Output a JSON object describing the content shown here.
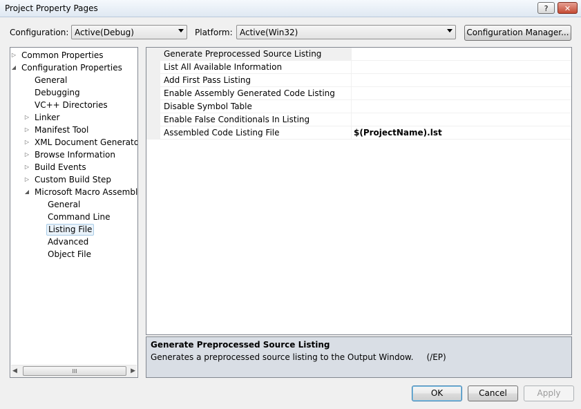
{
  "window": {
    "title": "Project Property Pages",
    "help_glyph": "?",
    "close_glyph": "✕"
  },
  "top": {
    "configuration_label": "Configuration:",
    "configuration_value": "Active(Debug)",
    "platform_label": "Platform:",
    "platform_value": "Active(Win32)",
    "config_manager_label": "Configuration Manager..."
  },
  "tree": {
    "items": [
      {
        "label": "Common Properties",
        "expander": "▷"
      },
      {
        "label": "Configuration Properties",
        "expander": "◢"
      },
      {
        "label": "General"
      },
      {
        "label": "Debugging"
      },
      {
        "label": "VC++ Directories"
      },
      {
        "label": "Linker",
        "expander": "▷"
      },
      {
        "label": "Manifest Tool",
        "expander": "▷"
      },
      {
        "label": "XML Document Generator",
        "expander": "▷"
      },
      {
        "label": "Browse Information",
        "expander": "▷"
      },
      {
        "label": "Build Events",
        "expander": "▷"
      },
      {
        "label": "Custom Build Step",
        "expander": "▷"
      },
      {
        "label": "Microsoft Macro Assembler",
        "expander": "◢"
      },
      {
        "label": "General"
      },
      {
        "label": "Command Line"
      },
      {
        "label": "Listing File",
        "selected": true
      },
      {
        "label": "Advanced"
      },
      {
        "label": "Object File"
      }
    ],
    "scroll_left": "◀",
    "scroll_right": "▶",
    "scroll_grip": "III"
  },
  "grid": {
    "rows": [
      {
        "name": "Generate Preprocessed Source Listing",
        "value": "",
        "selected": true
      },
      {
        "name": "List All Available Information",
        "value": ""
      },
      {
        "name": "Add First Pass Listing",
        "value": ""
      },
      {
        "name": "Enable Assembly Generated Code Listing",
        "value": ""
      },
      {
        "name": "Disable Symbol Table",
        "value": ""
      },
      {
        "name": "Enable False Conditionals In Listing",
        "value": ""
      },
      {
        "name": "Assembled Code Listing File",
        "value": "$(ProjectName).lst",
        "bold": true
      }
    ]
  },
  "description": {
    "title": "Generate Preprocessed Source Listing",
    "text": "Generates a preprocessed source listing to the Output Window.     (/EP)"
  },
  "buttons": {
    "ok": "OK",
    "cancel": "Cancel",
    "apply": "Apply"
  }
}
